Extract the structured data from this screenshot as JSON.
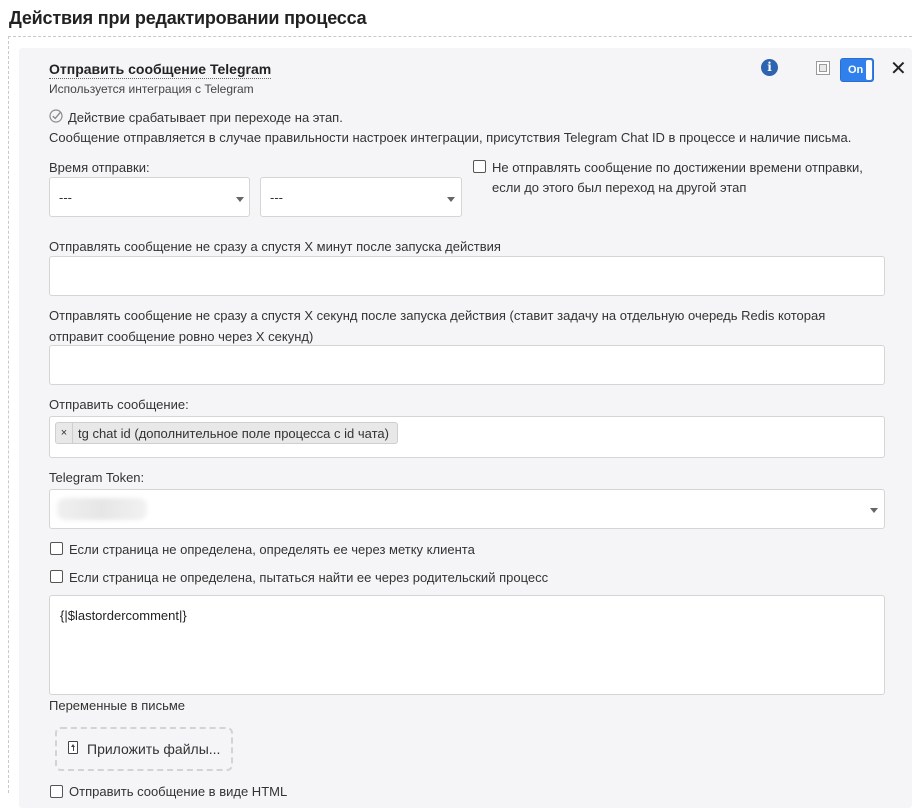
{
  "header": {
    "title": "Действия при редактировании процесса"
  },
  "card": {
    "title": "Отправить сообщение Telegram",
    "subtitle": "Используется интеграция с Telegram",
    "toggle_label": "On",
    "trigger_note": "Действие срабатывает при переходе на этап.",
    "description": "Сообщение отправляется в случае правильности настроек интеграции, присутствия Telegram Chat ID в процессе и наличие письма."
  },
  "send_time": {
    "label": "Время отправки:",
    "select_1_value": "---",
    "select_2_value": "---",
    "skip_checkbox_label_line1": "Не отправлять сообщение по достижении времени отправки,",
    "skip_checkbox_label_line2": "если до этого был переход на другой этап"
  },
  "delay_minutes": {
    "label": "Отправлять сообщение не сразу а спустя X минут после запуска действия",
    "value": ""
  },
  "delay_seconds": {
    "label_line1": "Отправлять сообщение не сразу а спустя X секунд после запуска действия (ставит задачу на отдельную очередь Redis которая",
    "label_line2": "отправит сообщение ровно через X секунд)",
    "value": ""
  },
  "send_to": {
    "label": "Отправить сообщение:",
    "tags": [
      {
        "remove": "×",
        "text": "tg chat id (дополнительное поле процесса с id чата)"
      }
    ]
  },
  "token": {
    "label": "Telegram Token:"
  },
  "options": {
    "detect_by_label": "Если страница не определена, определять ее через метку клиента",
    "detect_by_parent": "Если страница не определена, пытаться найти ее через родительский процесс",
    "send_as_html": "Отправить сообщение в виде HTML"
  },
  "message": {
    "value": "{|$lastordercomment|}",
    "variables_link": "Переменные в письме"
  },
  "attach": {
    "label": "Приложить файлы..."
  },
  "icons": {
    "info": "info-icon",
    "copy": "copy-icon",
    "close": "close-icon",
    "check": "check-circle-icon",
    "upload": "upload-icon"
  },
  "colors": {
    "accent": "#2f80ed",
    "info": "#2d63b0",
    "card_bg": "#f5f5f7"
  }
}
